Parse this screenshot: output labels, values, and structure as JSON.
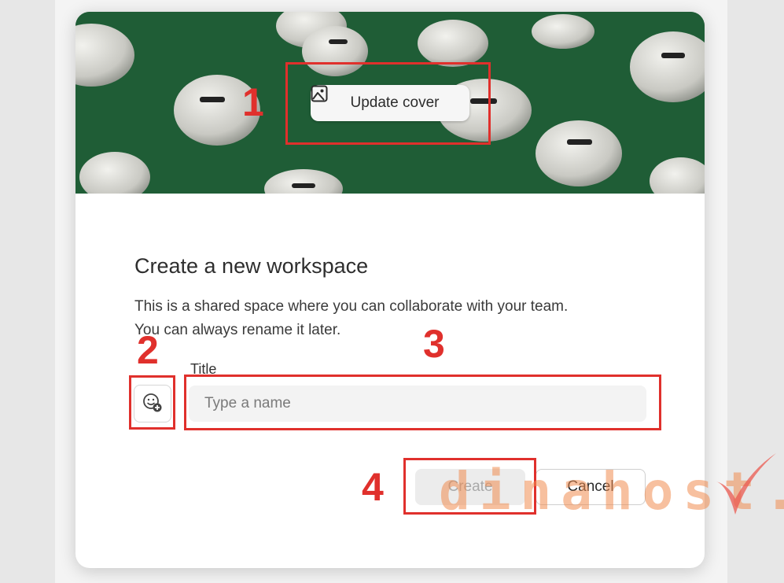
{
  "dialog": {
    "update_cover_label": "Update cover",
    "heading": "Create a new workspace",
    "description_line1": "This is a shared space where you can collaborate with your team.",
    "description_line2": "You can always rename it later.",
    "title_label": "Title",
    "name_placeholder": "Type a name",
    "name_value": "",
    "create_label": "Create",
    "cancel_label": "Cancel"
  },
  "annotations": {
    "one": "1",
    "two": "2",
    "three": "3",
    "four": "4"
  },
  "watermark": "dinahost.",
  "colors": {
    "cover_green": "#1d5b34",
    "annotation_red": "#e0302c",
    "watermark_orange": "#f08c50"
  },
  "icons": {
    "cover": "image-icon",
    "emoji": "emoji-add-icon",
    "watermark_mark": "checkmark-icon"
  }
}
